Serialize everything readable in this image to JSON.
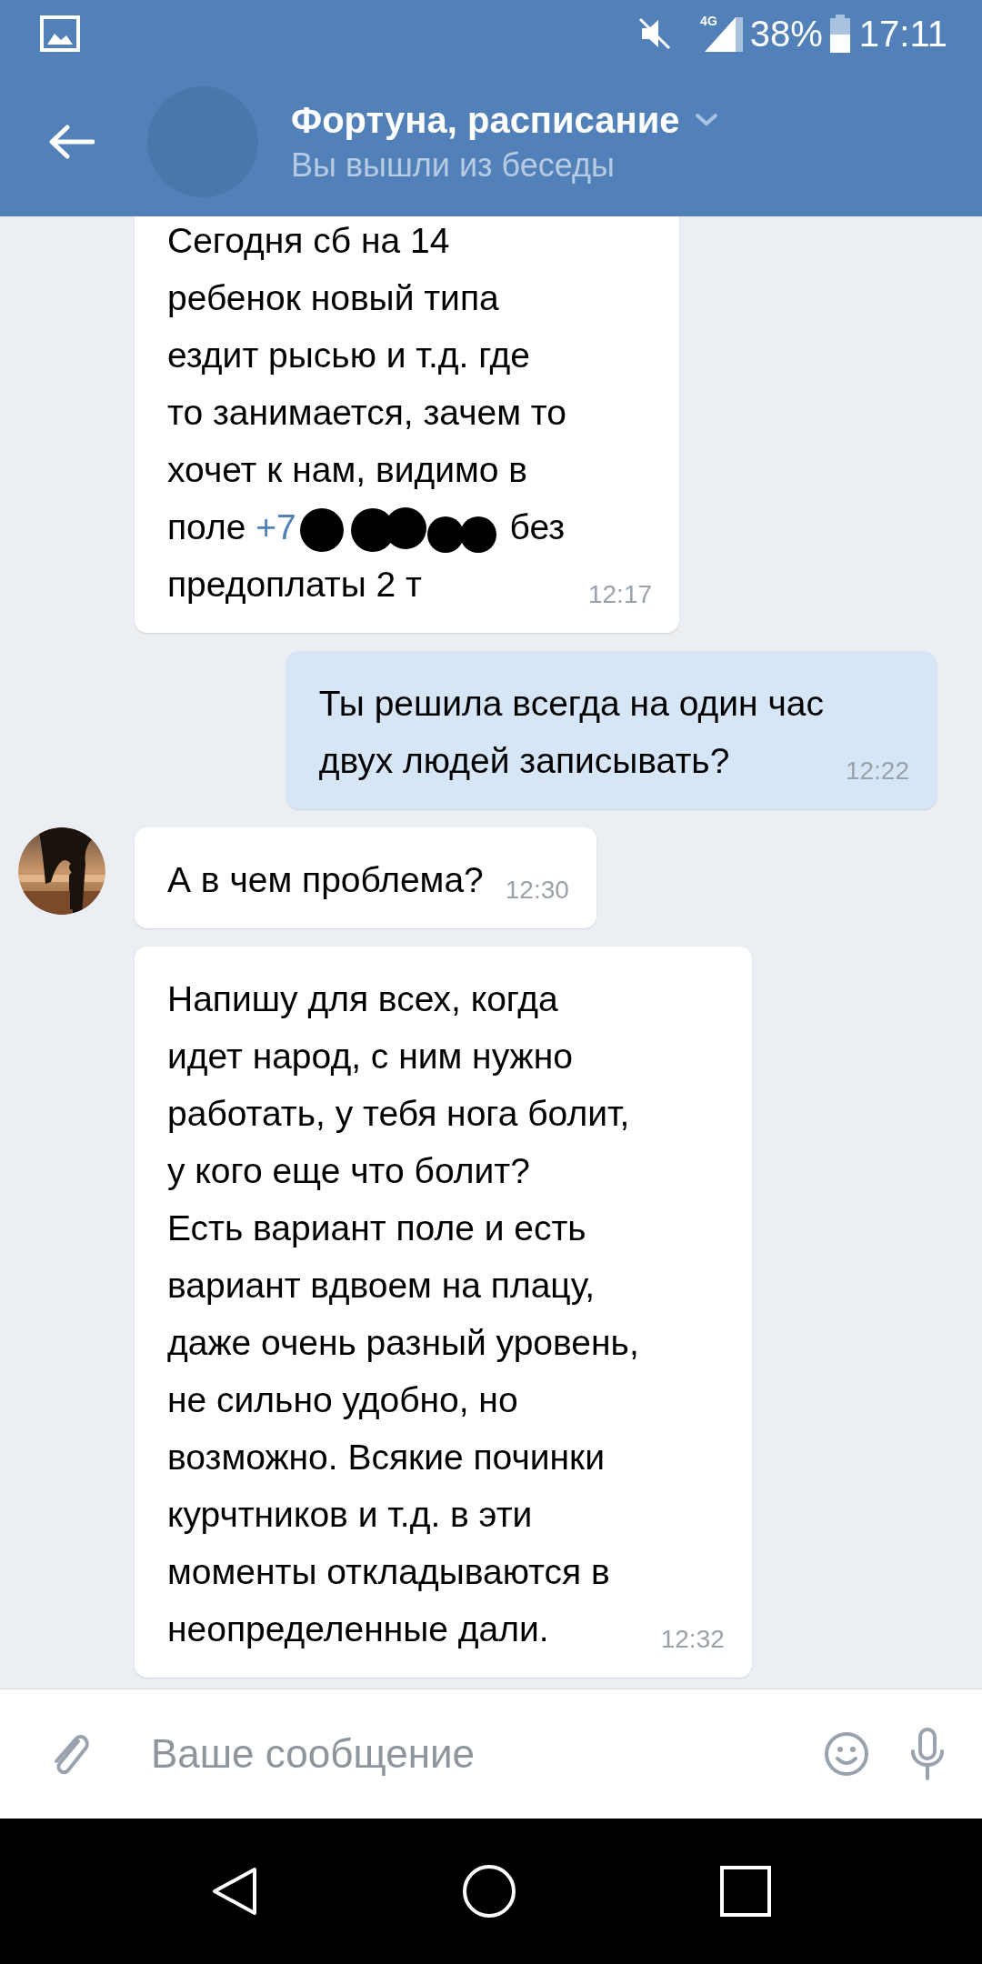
{
  "status_bar": {
    "battery": "38%",
    "time": "17:11",
    "network": "4G"
  },
  "header": {
    "title": "Фортуна, расписание",
    "subtitle": "Вы вышли из беседы"
  },
  "messages": [
    {
      "kind": "incoming",
      "show_avatar": false,
      "parts": [
        {
          "kind": "text",
          "text": "Сегодня сб на 14\nребенок новый типа\nездит рысью и т.д. где\nто занимается, зачем то\nхочет к нам, видимо в\nполе "
        },
        {
          "kind": "link",
          "text": "+7"
        },
        {
          "kind": "redaction"
        },
        {
          "kind": "text",
          "text": " без\nпредоплаты 2 т"
        }
      ],
      "time": "12:17"
    },
    {
      "kind": "outgoing",
      "parts": [
        {
          "kind": "text",
          "text": "Ты решила всегда на один час\nдвух людей записывать?"
        }
      ],
      "time": "12:22"
    },
    {
      "kind": "incoming",
      "show_avatar": true,
      "parts": [
        {
          "kind": "text",
          "text": "А в чем проблема?"
        }
      ],
      "time": "12:30"
    },
    {
      "kind": "incoming",
      "show_avatar": false,
      "parts": [
        {
          "kind": "text",
          "text": "Напишу для всех, когда\nидет народ, с ним нужно\nработать, у тебя нога болит,\nу кого еще что болит?\nЕсть вариант поле и есть\nвариант вдвоем на плацу,\nдаже очень разный уровень,\nне сильно удобно, но\nвозможно. Всякие починки\nкурчтников и т.д. в эти\nмоменты откладываются в\nнеопределенные дали."
        }
      ],
      "time": "12:32"
    }
  ],
  "composer": {
    "placeholder": "Ваше сообщение"
  }
}
